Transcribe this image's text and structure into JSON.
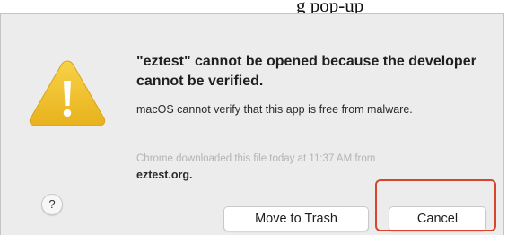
{
  "background": {
    "partial_text": "g pop-up"
  },
  "dialog": {
    "title": "\"eztest\" cannot be opened because the developer cannot be verified.",
    "message": "macOS cannot verify that this app is free from malware.",
    "source_text": "Chrome downloaded this file today at 11:37 AM from",
    "source_site": "eztest.org.",
    "icon": "warning-triangle-icon",
    "help_label": "?",
    "buttons": {
      "move_to_trash": "Move to Trash",
      "cancel": "Cancel"
    }
  },
  "colors": {
    "warning_yellow": "#f2c230",
    "highlight_red": "#d9452b",
    "dialog_bg": "#ececec"
  }
}
